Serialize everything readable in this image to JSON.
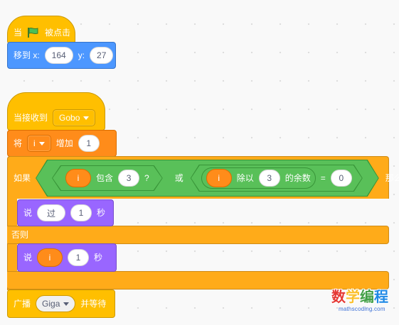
{
  "script1": {
    "hat": {
      "label": "当",
      "icon": "green-flag-icon",
      "suffix": "被点击"
    },
    "goto": {
      "label": "移到 x:",
      "x": "164",
      "y_label": "y:",
      "y": "27"
    }
  },
  "script2": {
    "hat": {
      "label": "当接收到",
      "message": "Gobo"
    },
    "change": {
      "label": "将",
      "variable": "i",
      "mid": "增加",
      "value": "1"
    },
    "ifelse": {
      "if_label": "如果",
      "then_label": "那么",
      "else_label": "否则",
      "contains": {
        "var": "i",
        "label": "包含",
        "value": "3",
        "q": "?"
      },
      "or_label": "或",
      "mod": {
        "var": "i",
        "label": "除以",
        "value": "3",
        "suffix": "的余数",
        "eq": "=",
        "rhs": "0"
      }
    },
    "say1": {
      "label": "说",
      "text": "过",
      "num": "1",
      "unit": "秒"
    },
    "say2": {
      "label": "说",
      "var": "i",
      "num": "1",
      "unit": "秒"
    },
    "broadcast": {
      "label": "广播",
      "message": "Giga",
      "suffix": "并等待"
    }
  },
  "logo": {
    "chars": [
      "数",
      "学",
      "编",
      "程"
    ],
    "sub": "mathscoding.com"
  },
  "colors": {
    "events": "#ffbf00",
    "motion": "#4c97ff",
    "variables": "#ff8c1a",
    "control": "#ffab19",
    "operators": "#59c059",
    "looks": "#9966ff"
  }
}
